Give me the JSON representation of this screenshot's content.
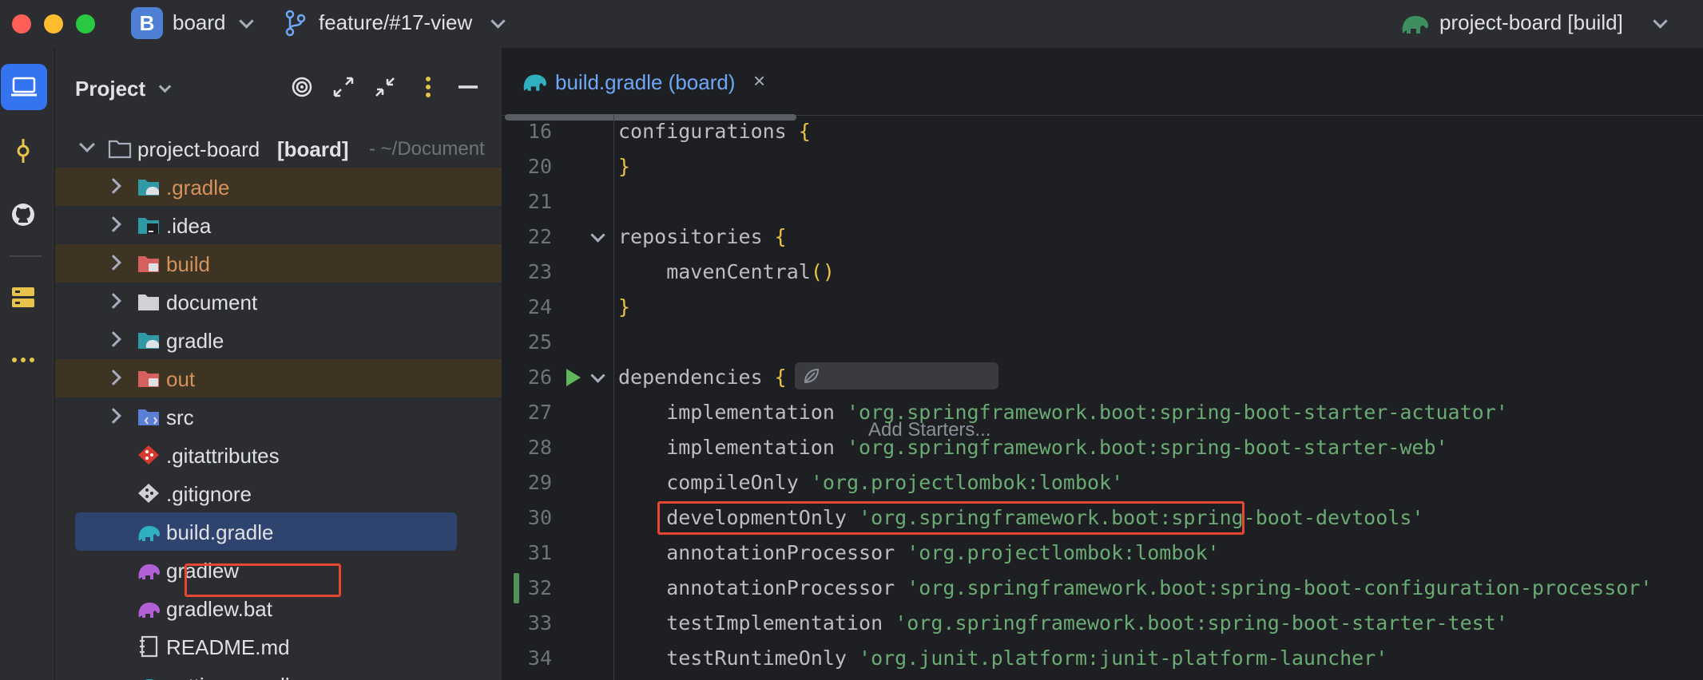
{
  "titlebar": {
    "project_badge": "B",
    "project_name": "board",
    "branch": "feature/#17-view",
    "run_config": "project-board [build]"
  },
  "toolstrip": {
    "icons": [
      "project-icon",
      "commit-icon",
      "github-icon",
      "services-icon",
      "more-icon"
    ],
    "active": "project-icon"
  },
  "project_panel": {
    "title": "Project",
    "root": {
      "name": "project-board",
      "module": "[board]",
      "path": "- ~/Document"
    },
    "items": [
      {
        "label": ".gradle",
        "type": "folder",
        "icon": "gradle-folder-icon",
        "expandable": true,
        "highlight": true
      },
      {
        "label": ".idea",
        "type": "folder",
        "icon": "idea-folder-icon",
        "expandable": true,
        "highlight": false
      },
      {
        "label": "build",
        "type": "folder",
        "icon": "build-folder-icon",
        "expandable": true,
        "highlight": true
      },
      {
        "label": "document",
        "type": "folder",
        "icon": "folder-icon",
        "expandable": true,
        "highlight": false
      },
      {
        "label": "gradle",
        "type": "folder",
        "icon": "gradle-folder-icon",
        "expandable": true,
        "highlight": false
      },
      {
        "label": "out",
        "type": "folder",
        "icon": "out-folder-icon",
        "expandable": true,
        "highlight": true
      },
      {
        "label": "src",
        "type": "folder",
        "icon": "source-folder-icon",
        "expandable": true,
        "highlight": false
      },
      {
        "label": ".gitattributes",
        "type": "file",
        "icon": "git-file-icon",
        "expandable": false,
        "highlight": false
      },
      {
        "label": ".gitignore",
        "type": "file",
        "icon": "gitignore-file-icon",
        "expandable": false,
        "highlight": false
      },
      {
        "label": "build.gradle",
        "type": "file",
        "icon": "gradle-file-icon",
        "expandable": false,
        "selected": true
      },
      {
        "label": "gradlew",
        "type": "file",
        "icon": "gradlew-file-icon",
        "expandable": false,
        "highlight": false
      },
      {
        "label": "gradlew.bat",
        "type": "file",
        "icon": "gradlew-file-icon",
        "expandable": false,
        "highlight": false
      },
      {
        "label": "README.md",
        "type": "file",
        "icon": "markdown-file-icon",
        "expandable": false,
        "highlight": false
      },
      {
        "label": "settings.gradle",
        "type": "file",
        "icon": "gradle-file-icon",
        "expandable": false,
        "highlight": false
      }
    ]
  },
  "editor": {
    "tab": {
      "label": "build.gradle (board)",
      "close": "×"
    },
    "lines": [
      {
        "n": "16",
        "code": "configurations ",
        "brace": "{"
      },
      {
        "n": "20",
        "code": "",
        "brace": "}"
      },
      {
        "n": "21",
        "code": ""
      },
      {
        "n": "22",
        "code": "repositories ",
        "brace": "{"
      },
      {
        "n": "23",
        "code": "    mavenCentral",
        "paren": "()"
      },
      {
        "n": "24",
        "code": "",
        "brace": "}"
      },
      {
        "n": "25",
        "code": ""
      },
      {
        "n": "26",
        "code": "dependencies ",
        "brace": "{"
      },
      {
        "n": "27",
        "code": "    implementation ",
        "str": "'org.springframework.boot:spring-boot-starter-actuator'"
      },
      {
        "n": "28",
        "code": "    implementation ",
        "str": "'org.springframework.boot:spring-boot-starter-web'"
      },
      {
        "n": "29",
        "code": "    compileOnly ",
        "str": "'org.projectlombok:lombok'"
      },
      {
        "n": "30",
        "code": "    developmentOnly ",
        "str": "'org.springframework.boot:spring-boot-devtools'"
      },
      {
        "n": "31",
        "code": "    annotationProcessor ",
        "str": "'org.projectlombok:lombok'"
      },
      {
        "n": "32",
        "code": "    annotationProcessor ",
        "str": "'org.springframework.boot:spring-boot-configuration-processor'"
      },
      {
        "n": "33",
        "code": "    testImplementation ",
        "str": "'org.springframework.boot:spring-boot-starter-test'"
      },
      {
        "n": "34",
        "code": "    testRuntimeOnly ",
        "str": "'org.junit.platform:junit-platform-launcher'"
      }
    ],
    "add_starters_hint": "Add Starters..."
  },
  "colors": {
    "accent": "#3574f0",
    "highlight_box": "#e5482e",
    "string": "#6aab73",
    "brace": "#e8c34a"
  }
}
